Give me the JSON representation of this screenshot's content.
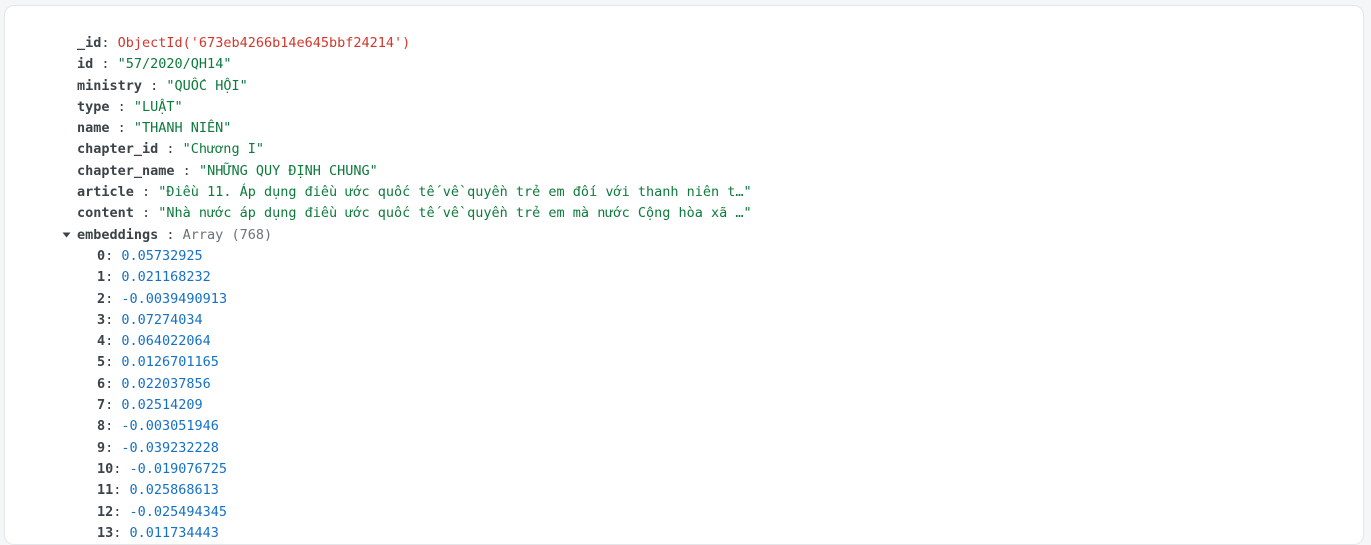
{
  "document": {
    "fields": [
      {
        "key": "_id",
        "sep": ": ",
        "value": "ObjectId('673eb4266b14e645bbf24214')",
        "kind": "oid"
      },
      {
        "key": "id",
        "sep": " : ",
        "value": "\"57/2020/QH14\"",
        "kind": "str"
      },
      {
        "key": "ministry",
        "sep": " : ",
        "value": "\"QUỐC HỘI\"",
        "kind": "str"
      },
      {
        "key": "type",
        "sep": " : ",
        "value": "\"LUẬT\"",
        "kind": "str"
      },
      {
        "key": "name",
        "sep": " : ",
        "value": "\"THANH NIÊN\"",
        "kind": "str"
      },
      {
        "key": "chapter_id",
        "sep": " : ",
        "value": "\"Chương I\"",
        "kind": "str"
      },
      {
        "key": "chapter_name",
        "sep": " : ",
        "value": "\"NHỮNG QUY ĐỊNH CHUNG\"",
        "kind": "str"
      },
      {
        "key": "article",
        "sep": " : ",
        "value": "\"Điều 11. Áp dụng điều ước quốc tế về quyền trẻ em đối với thanh niên t…\"",
        "kind": "str"
      },
      {
        "key": "content",
        "sep": " : ",
        "value": "\"Nhà nước áp dụng điều ước quốc tế về quyền trẻ em mà nước Cộng hòa xã …\"",
        "kind": "str"
      }
    ],
    "embeddings": {
      "key": "embeddings",
      "sep": " : ",
      "type_label": "Array (768)",
      "items": [
        {
          "index": "0",
          "value": "0.05732925"
        },
        {
          "index": "1",
          "value": "0.021168232"
        },
        {
          "index": "2",
          "value": "-0.0039490913"
        },
        {
          "index": "3",
          "value": "0.07274034"
        },
        {
          "index": "4",
          "value": "0.064022064"
        },
        {
          "index": "5",
          "value": "0.0126701165"
        },
        {
          "index": "6",
          "value": "0.022037856"
        },
        {
          "index": "7",
          "value": "0.02514209"
        },
        {
          "index": "8",
          "value": "-0.003051946"
        },
        {
          "index": "9",
          "value": "-0.039232228"
        },
        {
          "index": "10",
          "value": "-0.019076725"
        },
        {
          "index": "11",
          "value": "0.025868613"
        },
        {
          "index": "12",
          "value": "-0.025494345"
        },
        {
          "index": "13",
          "value": "0.011734443"
        }
      ]
    }
  }
}
